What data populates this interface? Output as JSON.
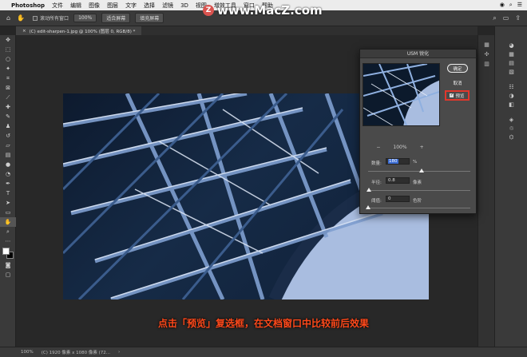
{
  "menubar": {
    "apple": "",
    "app": "Photoshop",
    "items": [
      "文件",
      "编辑",
      "图像",
      "图层",
      "文字",
      "选择",
      "滤镜",
      "3D",
      "视图",
      "增效工具",
      "窗口",
      "帮助"
    ]
  },
  "watermark": {
    "logo": "Z",
    "text": "www.MacZ.com"
  },
  "options": {
    "scroll_all_windows": "滚动所有窗口",
    "zoom": "100%",
    "fit_screen": "适合屏幕",
    "fill_screen": "填充屏幕"
  },
  "tab": {
    "title": "(C) edit-sharpen-1.jpg @ 100% (图层 0, RGB/8) *",
    "close": "×"
  },
  "dialog": {
    "title": "USM 锐化",
    "ok": "确定",
    "cancel": "取消",
    "preview": "预览",
    "zoom_out": "−",
    "zoom": "100%",
    "zoom_in": "+",
    "amount_label": "数量:",
    "amount_value": "180",
    "amount_unit": "%",
    "amount_fraction": 0.52,
    "radius_label": "半径:",
    "radius_value": "0.8",
    "radius_unit": "像素",
    "radius_fraction": 0.01,
    "threshold_label": "阈值:",
    "threshold_value": "0",
    "threshold_unit": "色阶",
    "threshold_fraction": 0.0
  },
  "status": {
    "zoom": "100%",
    "info": "(C) 1920 像素 x 1080 像素 (72...",
    "arrow": "›"
  },
  "caption": "点击「预览」复选框，在文档窗口中比较前后效果",
  "colors": {
    "accent_red": "#e0372c",
    "caption_red": "#ff4a1c",
    "selection_blue": "#3d6ed4"
  }
}
